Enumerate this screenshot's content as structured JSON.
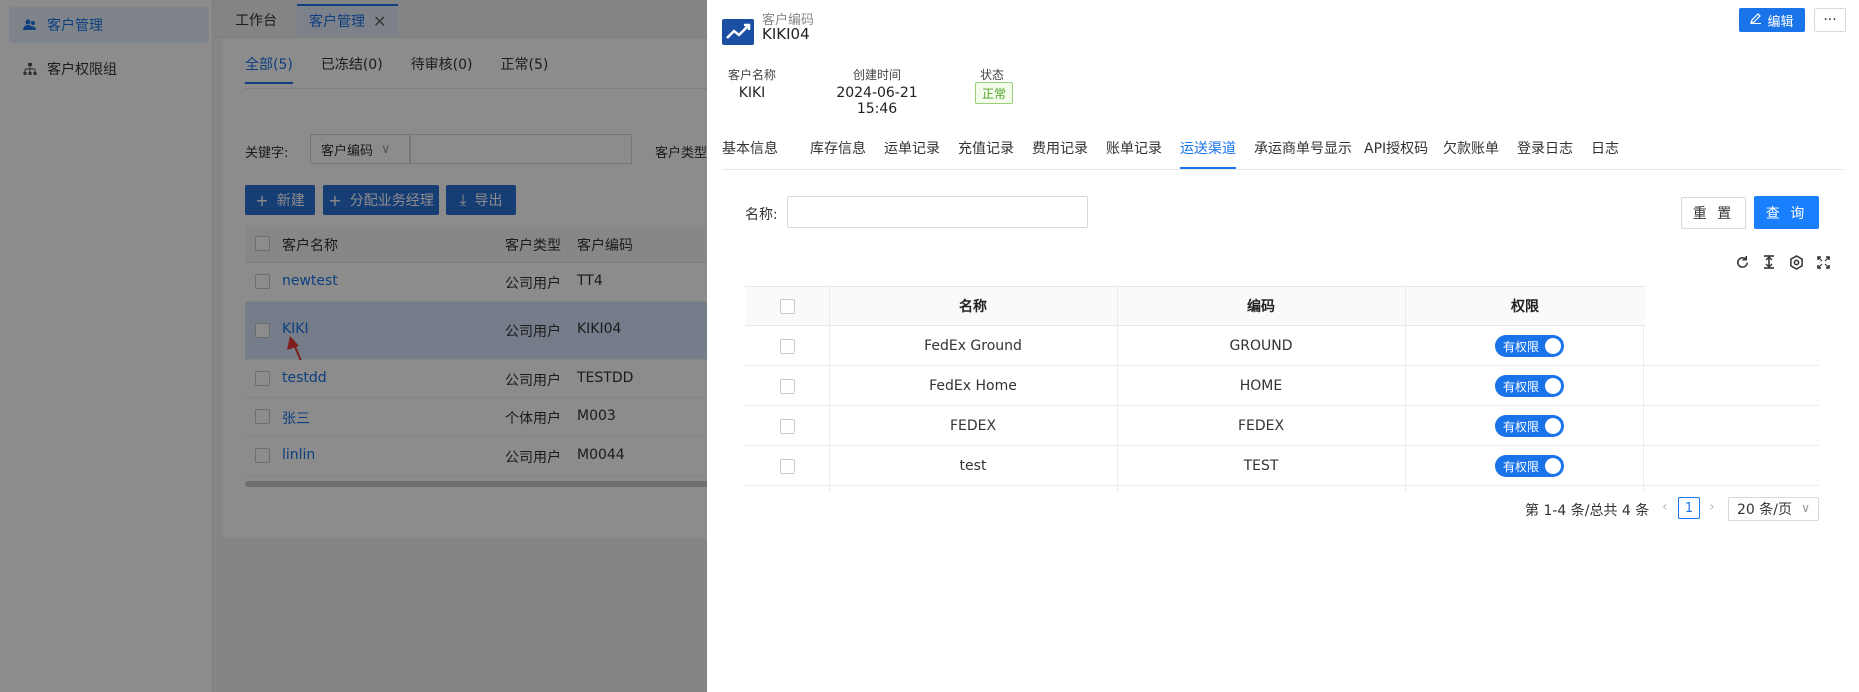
{
  "sidebar": {
    "items": [
      {
        "label": "客户管理",
        "icon": "users-icon"
      },
      {
        "label": "客户权限组",
        "icon": "org-tree-icon"
      }
    ]
  },
  "tabs": [
    {
      "label": "工作台"
    },
    {
      "label": "客户管理",
      "close": "✕"
    }
  ],
  "list": {
    "status_tabs": [
      "全部(5)",
      "已冻结(0)",
      "待审核(0)",
      "正常(5)"
    ],
    "keyword_label": "关键字:",
    "keyword_select": "客户编码",
    "customer_type_label": "客户类型：",
    "buttons": {
      "new": "新建",
      "assign": "分配业务经理",
      "export": "导出"
    },
    "columns": [
      "客户名称",
      "客户类型",
      "客户编码"
    ],
    "rows": [
      {
        "name": "newtest",
        "type": "公司用户",
        "code": "TT4"
      },
      {
        "name": "KIKI",
        "type": "公司用户",
        "code": "KIKI04"
      },
      {
        "name": "testdd",
        "type": "公司用户",
        "code": "TESTDD"
      },
      {
        "name": "张三",
        "type": "个体用户",
        "code": "M003"
      },
      {
        "name": "linlin",
        "type": "公司用户",
        "code": "M0044"
      }
    ]
  },
  "drawer": {
    "subtitle": "客户编码",
    "code": "KIKI04",
    "edit_label": "编辑",
    "more_label": "···",
    "meta": {
      "name_key": "客户名称",
      "name_val": "KIKI",
      "created_key": "创建时间",
      "created_val": "2024-06-21 15:46",
      "status_key": "状态",
      "status_val": "正常"
    },
    "tabs": [
      "基本信息",
      "库存信息",
      "运单记录",
      "充值记录",
      "费用记录",
      "账单记录",
      "运送渠道",
      "承运商单号显示",
      "API授权码",
      "欠款账单",
      "登录日志",
      "日志"
    ],
    "active_tab": "运送渠道",
    "filter": {
      "name_label": "名称:",
      "reset_label": "重 置",
      "query_label": "查 询"
    },
    "table": {
      "columns": [
        "名称",
        "编码",
        "权限"
      ],
      "rows": [
        {
          "name": "FedEx Ground",
          "code": "GROUND",
          "perm": "有权限"
        },
        {
          "name": "FedEx Home",
          "code": "HOME",
          "perm": "有权限"
        },
        {
          "name": "FEDEX",
          "code": "FEDEX",
          "perm": "有权限"
        },
        {
          "name": "test",
          "code": "TEST",
          "perm": "有权限"
        }
      ]
    },
    "pager": {
      "summary": "第 1-4 条/总共 4 条",
      "page": "1",
      "size": "20 条/页"
    }
  }
}
